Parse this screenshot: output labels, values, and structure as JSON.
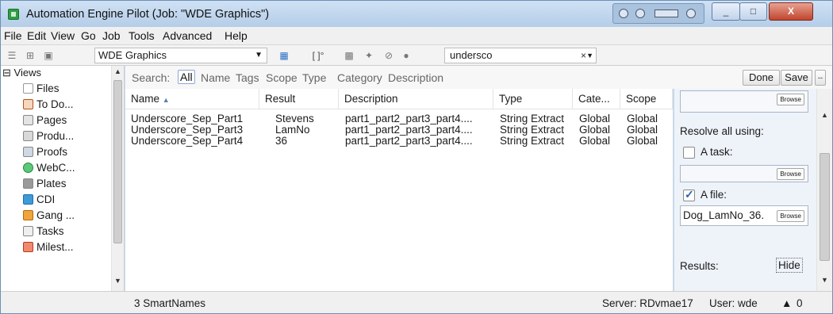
{
  "window": {
    "title": "Automation Engine Pilot (Job: \"WDE Graphics\")",
    "close": "X",
    "minimize": "_",
    "maximize": "□"
  },
  "menu": [
    "File",
    "Edit",
    "View",
    "Go",
    "Job",
    "Tools",
    "Advanced",
    "Help"
  ],
  "toolbar": {
    "job": "WDE Graphics",
    "search_value": "undersco",
    "bracket_label": "[ ]°"
  },
  "sidebar": {
    "header": "Views",
    "items": [
      {
        "label": "Files",
        "icon": "file-icon"
      },
      {
        "label": "To Do...",
        "icon": "todo-icon"
      },
      {
        "label": "Pages",
        "icon": "pages-icon"
      },
      {
        "label": "Produ...",
        "icon": "products-icon"
      },
      {
        "label": "Proofs",
        "icon": "proofs-icon"
      },
      {
        "label": "WebC...",
        "icon": "webcenter-icon"
      },
      {
        "label": "Plates",
        "icon": "plates-icon"
      },
      {
        "label": "CDI",
        "icon": "cdi-icon"
      },
      {
        "label": "Gang ...",
        "icon": "gang-icon"
      },
      {
        "label": "Tasks",
        "icon": "tasks-icon"
      },
      {
        "label": "Milest...",
        "icon": "milestones-icon"
      }
    ]
  },
  "filter": {
    "prefix": "Search:",
    "options": [
      "All",
      "Name",
      "Tags",
      "Scope",
      "Type",
      "Category",
      "Description"
    ],
    "done": "Done",
    "save": "Save",
    "more": "--"
  },
  "table": {
    "columns": [
      "Name",
      "Result",
      "Description",
      "Type",
      "Cate...",
      "Scope"
    ],
    "rows": [
      [
        "Underscore_Sep_Part1",
        "Stevens",
        "part1_part2_part3_part4....",
        "String Extract",
        "Global",
        "Global"
      ],
      [
        "Underscore_Sep_Part3",
        "LamNo",
        "part1_part2_part3_part4....",
        "String Extract",
        "Global",
        "Global"
      ],
      [
        "Underscore_Sep_Part4",
        "36",
        "part1_part2_part3_part4....",
        "String Extract",
        "Global",
        "Global"
      ]
    ]
  },
  "right_panel": {
    "browse": "Browse",
    "resolve_label": "Resolve all using:",
    "task_label": "A task:",
    "file_label": "A file:",
    "file_value": "Dog_LamNo_36.",
    "results_label": "Results:",
    "hide": "Hide",
    "task_checked": false,
    "file_checked": true
  },
  "status": {
    "count": "3 SmartNames",
    "server": "Server: RDvmae17",
    "user": "User: wde",
    "badge": "0"
  }
}
